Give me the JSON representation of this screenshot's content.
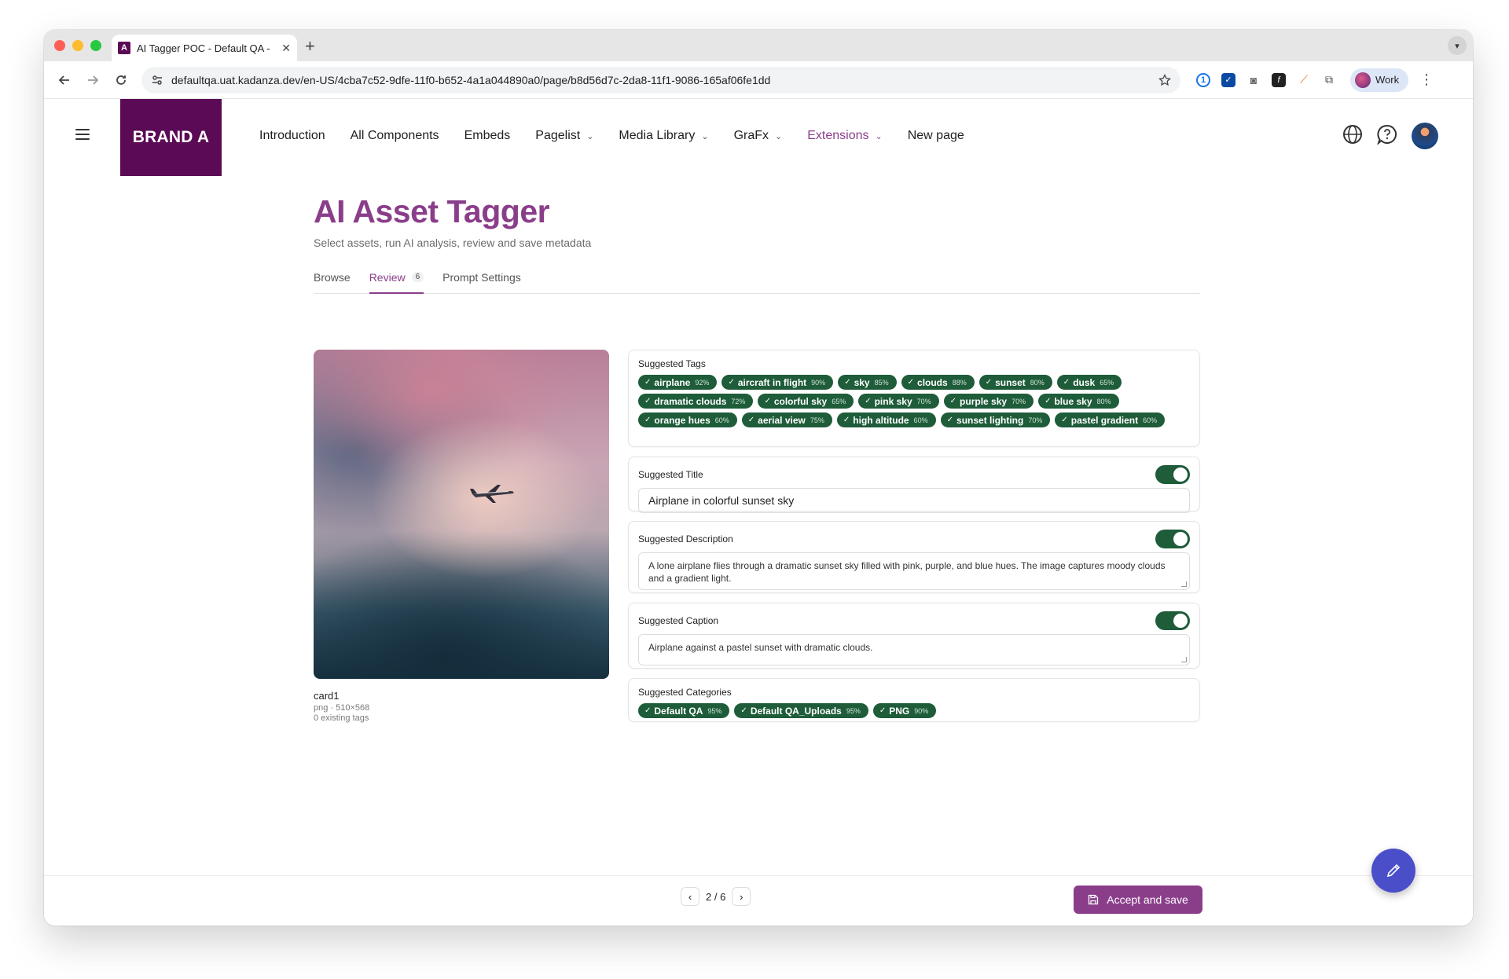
{
  "browser": {
    "tab_title": "AI Tagger POC - Default QA -",
    "favicon_letter": "A",
    "new_tab": "+",
    "close_tab": "✕",
    "url": "defaultqa.uat.kadanza.dev/en-US/4cba7c52-9dfe-11f0-b652-4a1a044890a0/page/b8d56d7c-2da8-11f1-9086-165af06fe1dd",
    "profile_label": "Work"
  },
  "header": {
    "brand": "BRAND A",
    "nav": [
      {
        "label": "Introduction"
      },
      {
        "label": "All Components"
      },
      {
        "label": "Embeds"
      },
      {
        "label": "Pagelist"
      },
      {
        "label": "Media Library"
      },
      {
        "label": "GraFx"
      },
      {
        "label": "Extensions"
      },
      {
        "label": "New page"
      }
    ]
  },
  "page": {
    "title": "AI Asset Tagger",
    "subtitle": "Select assets, run AI analysis, review and save metadata",
    "tabs": [
      {
        "label": "Browse"
      },
      {
        "label": "Review",
        "badge": "6"
      },
      {
        "label": "Prompt Settings"
      }
    ]
  },
  "asset": {
    "name": "card1",
    "info": "png · 510×568",
    "tags_count": "0 existing tags"
  },
  "suggested_tags": {
    "label": "Suggested Tags",
    "tags": [
      {
        "name": "airplane",
        "pct": "92%"
      },
      {
        "name": "aircraft in flight",
        "pct": "90%"
      },
      {
        "name": "sky",
        "pct": "85%"
      },
      {
        "name": "clouds",
        "pct": "88%"
      },
      {
        "name": "sunset",
        "pct": "80%"
      },
      {
        "name": "dusk",
        "pct": "65%"
      },
      {
        "name": "dramatic clouds",
        "pct": "72%"
      },
      {
        "name": "colorful sky",
        "pct": "65%"
      },
      {
        "name": "pink sky",
        "pct": "70%"
      },
      {
        "name": "purple sky",
        "pct": "70%"
      },
      {
        "name": "blue sky",
        "pct": "80%"
      },
      {
        "name": "orange hues",
        "pct": "60%"
      },
      {
        "name": "aerial view",
        "pct": "75%"
      },
      {
        "name": "high altitude",
        "pct": "60%"
      },
      {
        "name": "sunset lighting",
        "pct": "70%"
      },
      {
        "name": "pastel gradient",
        "pct": "60%"
      }
    ]
  },
  "suggested_title": {
    "label": "Suggested Title",
    "value": "Airplane in colorful sunset sky"
  },
  "suggested_description": {
    "label": "Suggested Description",
    "value": "A lone airplane flies through a dramatic sunset sky filled with pink, purple, and blue hues. The image captures moody clouds and a gradient light."
  },
  "suggested_caption": {
    "label": "Suggested Caption",
    "value": "Airplane against a pastel sunset with dramatic clouds."
  },
  "suggested_categories": {
    "label": "Suggested Categories",
    "items": [
      {
        "name": "Default QA",
        "pct": "95%"
      },
      {
        "name": "Default QA_Uploads",
        "pct": "95%"
      },
      {
        "name": "PNG",
        "pct": "90%"
      }
    ]
  },
  "footer": {
    "pager": "2 / 6",
    "save_label": "Accept and save"
  },
  "colors": {
    "brand": "#5b0a55",
    "accent": "#8a3e8a",
    "chip": "#1e5c3a",
    "fab": "#4b4ec9"
  }
}
